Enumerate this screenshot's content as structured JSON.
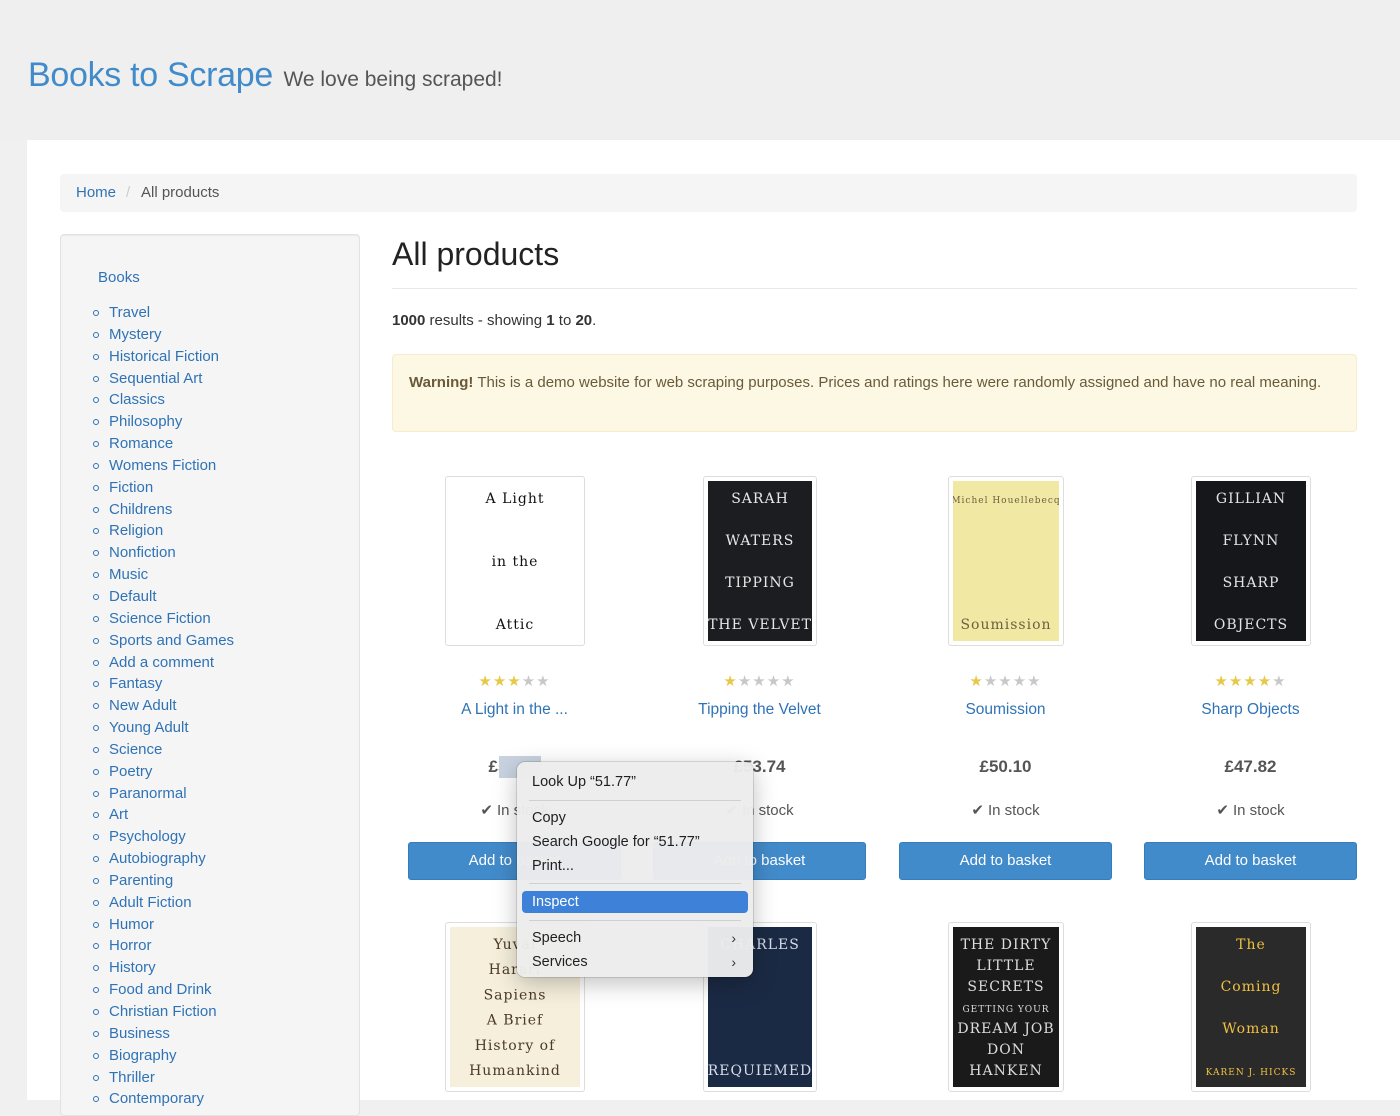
{
  "header": {
    "title": "Books to Scrape",
    "tagline": "We love being scraped!"
  },
  "breadcrumb": {
    "home": "Home",
    "separator": "/",
    "current": "All products"
  },
  "sidebar": {
    "heading": "Books",
    "categories": [
      "Travel",
      "Mystery",
      "Historical Fiction",
      "Sequential Art",
      "Classics",
      "Philosophy",
      "Romance",
      "Womens Fiction",
      "Fiction",
      "Childrens",
      "Religion",
      "Nonfiction",
      "Music",
      "Default",
      "Science Fiction",
      "Sports and Games",
      "Add a comment",
      "Fantasy",
      "New Adult",
      "Young Adult",
      "Science",
      "Poetry",
      "Paranormal",
      "Art",
      "Psychology",
      "Autobiography",
      "Parenting",
      "Adult Fiction",
      "Humor",
      "Horror",
      "History",
      "Food and Drink",
      "Christian Fiction",
      "Business",
      "Biography",
      "Thriller",
      "Contemporary"
    ]
  },
  "main": {
    "title": "All products",
    "results": {
      "total": "1000",
      "text1": " results - showing ",
      "from": "1",
      "text2": " to ",
      "to": "20",
      "end": "."
    },
    "warning": {
      "strong": "Warning!",
      "text": " This is a demo website for web scraping purposes. Prices and ratings here were randomly assigned and have no real meaning."
    }
  },
  "products": [
    {
      "title": "A Light in the ...",
      "price": "£51.77",
      "stock": "In stock",
      "rating": 3,
      "button": "Add to basket",
      "cover": {
        "bg": "#ffffff",
        "fg": "#111111",
        "lines": [
          "A Light",
          "in the",
          "Attic"
        ]
      }
    },
    {
      "title": "Tipping the Velvet",
      "price": "£53.74",
      "stock": "In stock",
      "rating": 1,
      "button": "Add to basket",
      "cover": {
        "bg": "#1b1d20",
        "fg": "#e8e8e8",
        "lines": [
          "SARAH",
          "WATERS",
          "TIPPING",
          "THE VELVET"
        ]
      }
    },
    {
      "title": "Soumission",
      "price": "£50.10",
      "stock": "In stock",
      "rating": 1,
      "button": "Add to basket",
      "cover": {
        "bg": "#f1e8a4",
        "fg": "#6b6240",
        "lines": [
          "Michel Houellebecq",
          "Soumission"
        ]
      }
    },
    {
      "title": "Sharp Objects",
      "price": "£47.82",
      "stock": "In stock",
      "rating": 4,
      "button": "Add to basket",
      "cover": {
        "bg": "#15171b",
        "fg": "#e4e4e4",
        "lines": [
          "GILLIAN",
          "FLYNN",
          "SHARP",
          "OBJECTS"
        ]
      }
    },
    {
      "cover": {
        "bg": "#f6efdc",
        "fg": "#4a3a2a",
        "lines": [
          "Yuval",
          "Harari",
          "Sapiens",
          "A Brief",
          "History of",
          "Humankind"
        ]
      }
    },
    {
      "cover": {
        "bg": "#1b2a44",
        "fg": "#d8dce8",
        "lines": [
          "CHARLES",
          "REQUIEMED"
        ]
      }
    },
    {
      "cover": {
        "bg": "#1a1a1a",
        "fg": "#dddddd",
        "lines": [
          "THE DIRTY",
          "LITTLE",
          "SECRETS",
          "GETTING YOUR",
          "DREAM JOB",
          "DON",
          "HANKEN"
        ]
      }
    },
    {
      "cover": {
        "bg": "#2a2a2a",
        "fg": "#f0c040",
        "lines": [
          "The",
          "Coming",
          "Woman",
          "KAREN J. HICKS"
        ]
      }
    }
  ],
  "context_menu": {
    "look_up": "Look Up “51.77”",
    "copy": "Copy",
    "search": "Search Google for “51.77”",
    "print": "Print...",
    "inspect": "Inspect",
    "speech": "Speech",
    "services": "Services",
    "chevron": "›"
  },
  "colors": {
    "brand": "#428bca",
    "link": "#2f73b6",
    "button": "#428bca",
    "star": "#e6c94a",
    "warning_bg": "#fcf8e3",
    "menu_highlight": "#3d82d8"
  },
  "icons": {
    "check": "✔",
    "star": "★"
  }
}
